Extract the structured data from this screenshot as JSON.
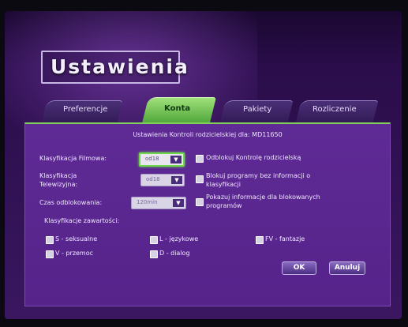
{
  "page": {
    "title": "Ustawienia"
  },
  "tabs": [
    {
      "label": "Preferencje",
      "active": false
    },
    {
      "label": "Konta",
      "active": true
    },
    {
      "label": "Pakiety",
      "active": false
    },
    {
      "label": "Rozliczenie",
      "active": false
    }
  ],
  "parental": {
    "subheader": "Ustawienia Kontroli rodzicielskiej dla: MD11650",
    "film_rating_label": "Klasyfikacja Filmowa:",
    "film_rating_value": "od18",
    "tv_rating_label_1": "Klasyfikacja",
    "tv_rating_label_2": "Telewizyjna:",
    "tv_rating_value": "od18",
    "unlock_time_label": "Czas odblokowania:",
    "unlock_time_value": "120min",
    "content_class_label": "Klasyfikacje zawartości:",
    "options": {
      "unlock_parental": "Odblokuj Kontrolę rodzicielską",
      "block_unrated_1": "Blokuj programy bez informacji o",
      "block_unrated_2": "klasyfikacji",
      "show_blocked_info_1": "Pokazuj informacje dla blokowanych",
      "show_blocked_info_2": "programów"
    },
    "content_flags": {
      "s": "S - seksualne",
      "l": "L - językowe",
      "fv": "FV - fantazje",
      "v": "V - przemoc",
      "d": "D - dialog"
    }
  },
  "buttons": {
    "ok": "OK",
    "cancel": "Anuluj"
  },
  "colors": {
    "accent_green": "#6fd84a",
    "panel_purple": "#5f2a95"
  }
}
